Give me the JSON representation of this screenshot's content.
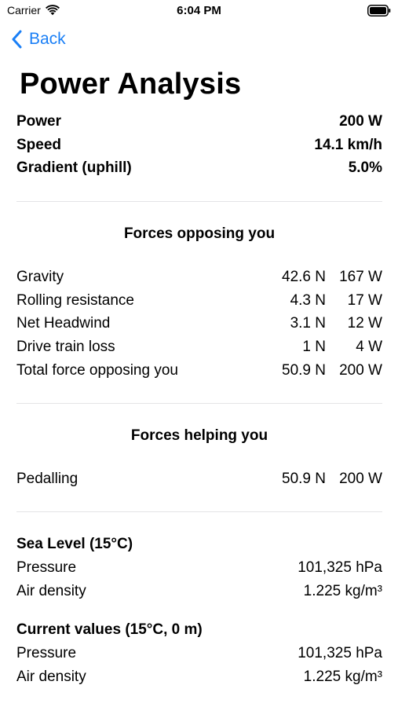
{
  "status_bar": {
    "carrier": "Carrier",
    "time": "6:04 PM"
  },
  "nav": {
    "back_label": "Back"
  },
  "title": "Power Analysis",
  "summary": [
    {
      "label": "Power",
      "value": "200 W"
    },
    {
      "label": "Speed",
      "value": "14.1 km/h"
    },
    {
      "label": "Gradient (uphill)",
      "value": "5.0%"
    }
  ],
  "opposing": {
    "header": "Forces opposing you",
    "rows": [
      {
        "label": "Gravity",
        "force": "42.6 N",
        "power": "167 W"
      },
      {
        "label": "Rolling resistance",
        "force": "4.3 N",
        "power": "17 W"
      },
      {
        "label": "Net Headwind",
        "force": "3.1 N",
        "power": "12 W"
      },
      {
        "label": "Drive train loss",
        "force": "1 N",
        "power": "4 W"
      },
      {
        "label": "Total force opposing you",
        "force": "50.9 N",
        "power": "200 W"
      }
    ]
  },
  "helping": {
    "header": "Forces helping you",
    "rows": [
      {
        "label": "Pedalling",
        "force": "50.9 N",
        "power": "200 W"
      }
    ]
  },
  "sea_level": {
    "title": "Sea Level (15°C)",
    "rows": [
      {
        "label": "Pressure",
        "value": "101,325 hPa"
      },
      {
        "label": "Air density",
        "value": "1.225 kg/m³"
      }
    ]
  },
  "current": {
    "title": "Current values (15°C, 0 m)",
    "rows": [
      {
        "label": "Pressure",
        "value": "101,325 hPa"
      },
      {
        "label": "Air density",
        "value": "1.225 kg/m³"
      }
    ]
  },
  "colors": {
    "accent": "#1a7ff6",
    "divider": "#e4e4e6"
  }
}
